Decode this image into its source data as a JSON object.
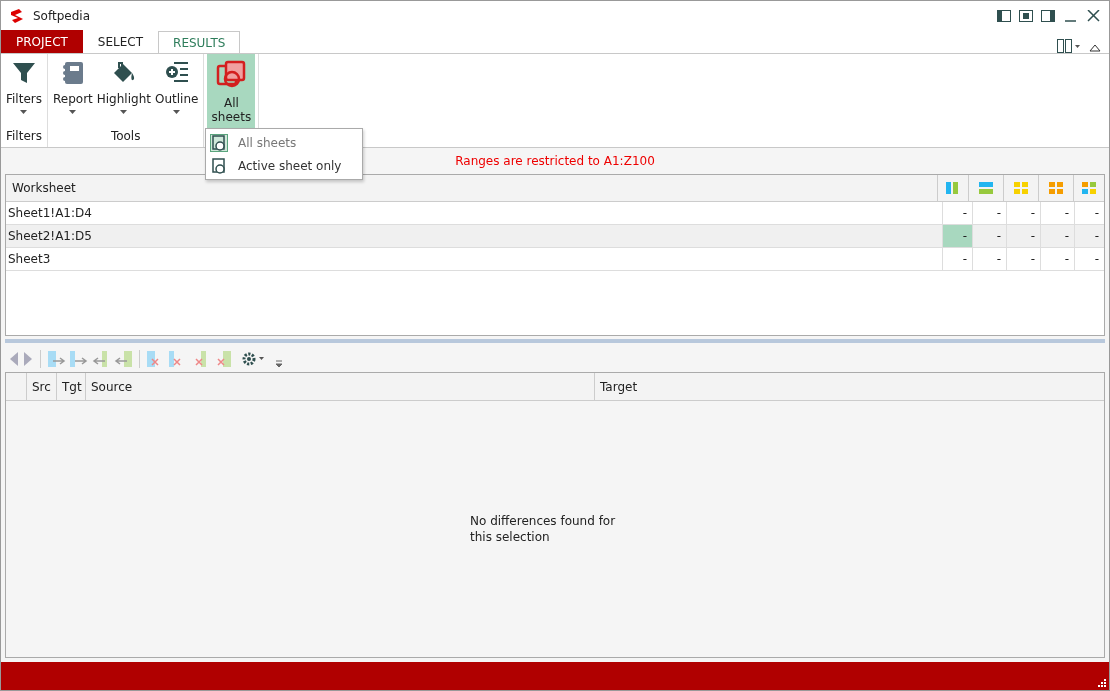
{
  "window": {
    "title": "Softpedia"
  },
  "tabs": [
    {
      "label": "PROJECT",
      "kind": "app",
      "selected": false
    },
    {
      "label": "SELECT",
      "kind": "plain",
      "selected": false
    },
    {
      "label": "RESULTS",
      "kind": "plain",
      "selected": true
    }
  ],
  "ribbon": {
    "groups": [
      {
        "label": "Filters",
        "buttons": [
          {
            "label": "Filters",
            "kind": "filter",
            "selected": false
          }
        ]
      },
      {
        "label": "Tools",
        "buttons": [
          {
            "label": "Report",
            "kind": "report",
            "selected": false
          },
          {
            "label": "Highlight",
            "kind": "highlight",
            "selected": false
          },
          {
            "label": "Outline",
            "kind": "outline",
            "selected": false
          }
        ]
      },
      {
        "buttons": [
          {
            "label": "All sheets",
            "kind": "sheets",
            "selected": true
          }
        ]
      }
    ]
  },
  "dropdown": {
    "items": [
      {
        "label": "All sheets",
        "selected": true
      },
      {
        "label": "Active sheet only",
        "selected": false
      }
    ]
  },
  "notice": "Ranges are restricted to A1:Z100",
  "worksheets": {
    "header": "Worksheet",
    "rows": [
      {
        "name": "Sheet1!A1:D4",
        "selected": false,
        "cells": [
          {
            "text": "-",
            "selected": false
          },
          {
            "text": "-",
            "selected": false
          },
          {
            "text": "-",
            "selected": false
          },
          {
            "text": "-",
            "selected": false
          },
          {
            "text": "-",
            "selected": false
          }
        ]
      },
      {
        "name": "Sheet2!A1:D5",
        "selected": true,
        "cells": [
          {
            "text": "-",
            "selected": true
          },
          {
            "text": "-",
            "selected": false
          },
          {
            "text": "-",
            "selected": false
          },
          {
            "text": "-",
            "selected": false
          },
          {
            "text": "-",
            "selected": false
          }
        ]
      },
      {
        "name": "Sheet3",
        "selected": false,
        "cells": [
          {
            "text": "-",
            "selected": false
          },
          {
            "text": "-",
            "selected": false
          },
          {
            "text": "-",
            "selected": false
          },
          {
            "text": "-",
            "selected": false
          },
          {
            "text": "-",
            "selected": false
          }
        ]
      }
    ]
  },
  "differences": {
    "columns": [
      "Src",
      "Tgt",
      "Source",
      "Target"
    ],
    "empty_message": "No differences found for this selection"
  }
}
